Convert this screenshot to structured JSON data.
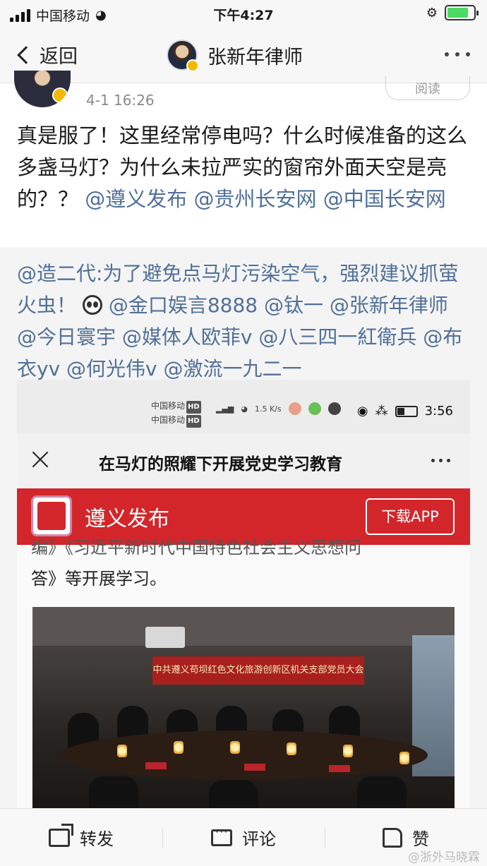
{
  "status_bar": {
    "carrier": "中国移动",
    "time": "下午4:27"
  },
  "nav": {
    "back_label": "返回",
    "title": "张新年律师"
  },
  "post": {
    "time": "4-1 16:26",
    "read_label": "阅读",
    "text_plain": "真是服了！这里经常停电吗？什么时候准备的这么多盏马灯？为什么未拉严实的窗帘外面天空是亮的？？",
    "mentions": [
      "@遵义发布",
      "@贵州长安网",
      "@中国长安网"
    ]
  },
  "repost": {
    "lead": "@造二代:为了避免点马灯污染空气，强烈建议抓萤火虫！",
    "mentions": "@金口娱言8888 @钛一 @张新年律师 @今日寰宇 @媒体人欧菲v @八三四一紅衛兵 @布衣yv @何光伟v @激流一九二一",
    "screenshot": {
      "carrier1": "中国移动",
      "carrier2": "中国移动",
      "hd": "HD",
      "net_speed": "1.5 K/s",
      "time": "3:56",
      "title": "在马灯的照耀下开展党史学习教育",
      "app_name": "遵义发布",
      "download_label": "下载APP",
      "article_cut": "编》《习近平新时代中国特色社会主义思想问",
      "article_line": "答》等开展学习。",
      "photo_banner": "中共遵义苟坝红色文化旅游创新区机关支部党员大会"
    }
  },
  "toolbar": {
    "repost": "转发",
    "comment": "评论",
    "like": "赞"
  },
  "watermark": "@浙外马晓霖",
  "colors": {
    "mention": "#50709a",
    "banner_red": "#d3262b",
    "repost_bg": "#f4f4f4"
  }
}
